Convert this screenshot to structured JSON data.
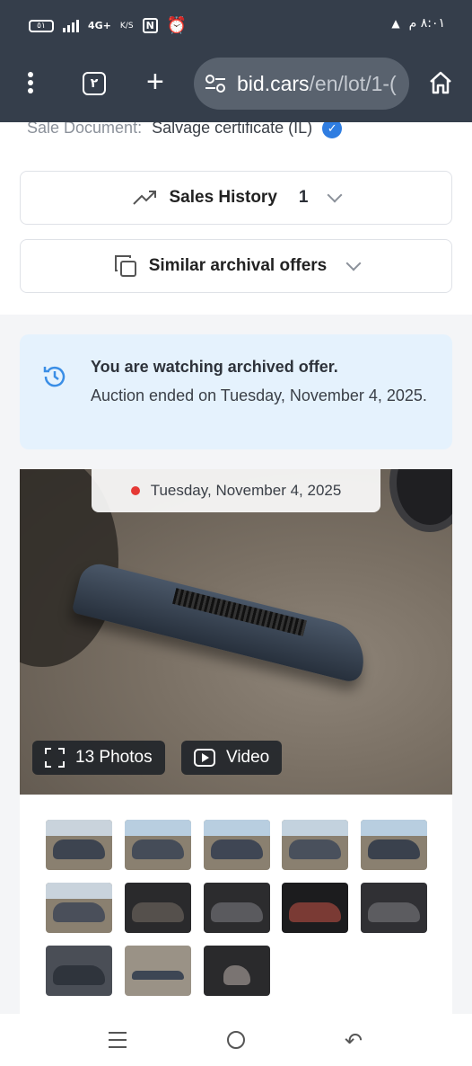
{
  "status_bar": {
    "battery": "٥١",
    "network": "4G+",
    "speed_unit": "K/S",
    "nfc": "N",
    "time": "٨:٠١ م"
  },
  "browser": {
    "tab_count": "٢",
    "url_host": "bid.cars",
    "url_path": "/en/lot/1-(",
    "icons": [
      "more-vert-icon",
      "tabs-icon",
      "plus-icon",
      "site-settings-icon",
      "home-icon"
    ]
  },
  "sale_document": {
    "label": "Sale Document:",
    "value": "Salvage certificate (IL)"
  },
  "sales_history": {
    "title": "Sales History",
    "count": "1"
  },
  "similar_offers": {
    "title": "Similar archival offers"
  },
  "notice": {
    "title": "You are watching archived offer.",
    "body": "Auction ended on Tuesday, November 4, 2025."
  },
  "gallery": {
    "date": "Tuesday, November 4, 2025",
    "photos_label": "13 Photos",
    "video_label": "Video",
    "thumbnail_count": 13
  },
  "colors": {
    "browser_bar": "#353e4b",
    "notice_bg": "#e5f2fd",
    "verified_badge": "#2f7de1",
    "date_dot": "#e53935"
  }
}
